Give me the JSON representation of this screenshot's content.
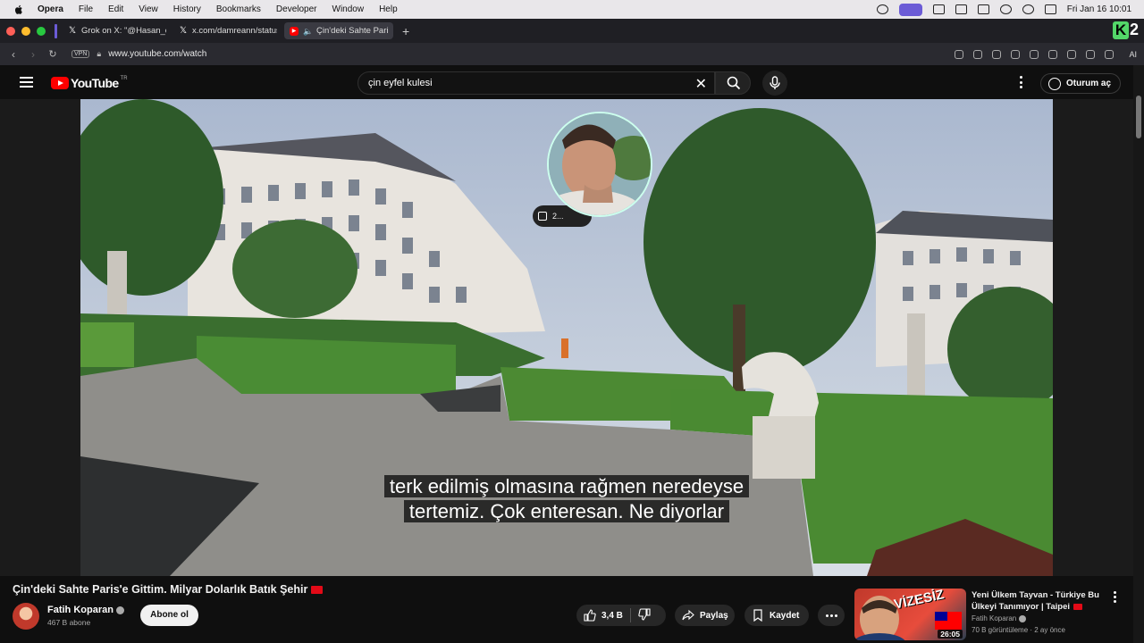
{
  "menubar": {
    "app": "Opera",
    "items": [
      "File",
      "Edit",
      "View",
      "History",
      "Bookmarks",
      "Developer",
      "Window",
      "Help"
    ],
    "clock": "Fri Jan 16  10:01"
  },
  "tabs": [
    {
      "icon": "x-icon",
      "title": "Grok on X: \"@Hasan_ce"
    },
    {
      "icon": "x-icon",
      "title": "x.com/damreann/status/"
    },
    {
      "icon": "youtube-icon",
      "title": "Çin'deki Sahte Paris"
    }
  ],
  "address": {
    "vpn": "VPN",
    "url": "www.youtube.com/watch",
    "ai_label": "AI"
  },
  "branding": {
    "k2_letter": "K",
    "k2_number": "2"
  },
  "youtube": {
    "logo": "YouTube",
    "country": "TR",
    "search_query": "çin eyfel kulesi",
    "signin": "Oturum aç"
  },
  "video": {
    "subtitle_line1": "terk edilmiş olmasına rağmen neredeyse",
    "subtitle_line2": "tertemiz. Çok enteresan. Ne diyorlar",
    "pip_badge": "2..."
  },
  "details": {
    "title": "Çin'deki Sahte Paris'e Gittim. Milyar Dolarlık Batık Şehir",
    "channel": "Fatih Koparan",
    "subscribers": "467 B abone",
    "subscribe_label": "Abone ol",
    "likes": "3,4 B",
    "share": "Paylaş",
    "save": "Kaydet"
  },
  "recommendation": {
    "title": "Yeni Ülkem Tayvan - Türkiye Bu Ülkeyi Tanımıyor | Taipei",
    "channel": "Fatih Koparan",
    "meta": "70 B görüntüleme · 2 ay önce",
    "duration": "26:05",
    "thumb_text": "VİZESİZ"
  },
  "colors": {
    "youtube_red": "#ff0000",
    "background": "#0f0f0f",
    "menubar": "#e9e7ea"
  }
}
